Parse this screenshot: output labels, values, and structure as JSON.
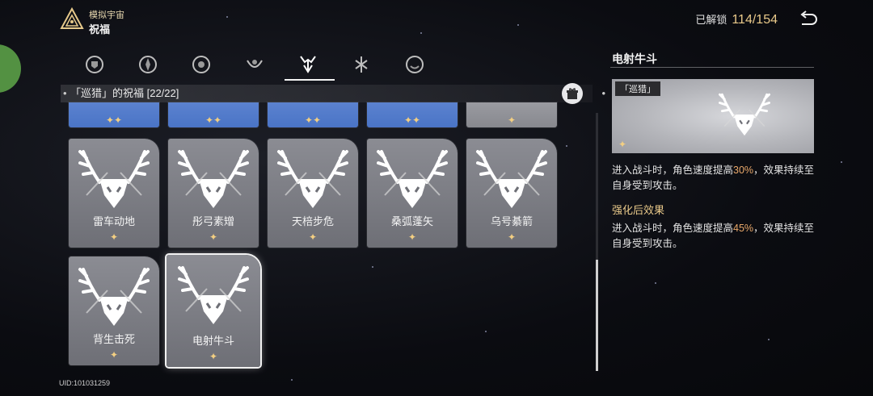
{
  "header": {
    "mode": "模拟宇宙",
    "title": "祝福",
    "unlock_label": "已解锁",
    "unlock_count": "114/154"
  },
  "tabs": [
    {
      "name": "tab-preservation",
      "active": false
    },
    {
      "name": "tab-remembrance",
      "active": false
    },
    {
      "name": "tab-nihility",
      "active": false
    },
    {
      "name": "tab-abundance",
      "active": false
    },
    {
      "name": "tab-the-hunt",
      "active": true
    },
    {
      "name": "tab-destruction",
      "active": false
    },
    {
      "name": "tab-elation",
      "active": false
    }
  ],
  "section": {
    "label": "「巡猎」的祝福 [22/22]"
  },
  "partial_row": [
    {
      "stars": "✦✦",
      "color": "blue"
    },
    {
      "stars": "✦✦",
      "color": "blue"
    },
    {
      "stars": "✦✦",
      "color": "blue"
    },
    {
      "stars": "✦✦",
      "color": "blue"
    },
    {
      "stars": "✦",
      "color": "gray"
    }
  ],
  "cards_row1": [
    {
      "name": "雷车动地",
      "stars": "✦"
    },
    {
      "name": "彤弓素矰",
      "stars": "✦"
    },
    {
      "name": "天棓步危",
      "stars": "✦"
    },
    {
      "name": "桑弧蓬矢",
      "stars": "✦"
    },
    {
      "name": "乌号綦箭",
      "stars": "✦"
    }
  ],
  "cards_row2": [
    {
      "name": "背生击死",
      "stars": "✦"
    },
    {
      "name": "电射牛斗",
      "stars": "✦",
      "selected": true
    }
  ],
  "detail": {
    "title": "电射牛斗",
    "path_tag": "「巡猎」",
    "stars": "✦",
    "desc_pre": "进入战斗时，角色速度提高",
    "desc_value": "30%",
    "desc_post": "，效果持续至自身受到攻击。",
    "enhanced_heading": "强化后效果",
    "enh_pre": "进入战斗时，角色速度提高",
    "enh_value": "45%",
    "enh_post": "，效果持续至自身受到攻击。"
  },
  "footer": {
    "uid": "UID:101031259"
  },
  "colors": {
    "gold": "#e9c98a",
    "star": "#f3cf82",
    "highlight": "#e9a86a",
    "strip_blue": "#4a74c6"
  }
}
